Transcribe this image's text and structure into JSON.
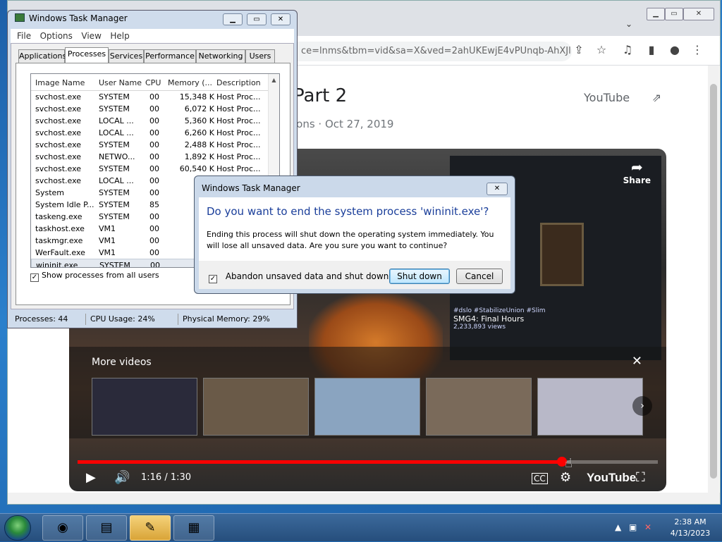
{
  "chrome": {
    "url": "ce=lnms&tbm=vid&sa=X&ved=2ahUKEwjE4vPUnqb-AhXJl...",
    "page_title": "Part 2",
    "page_subtitle": "ions · Oct 27, 2019",
    "youtube_button": "YouTube",
    "icons": [
      "share-icon",
      "bookmark-star-icon",
      "media-icon",
      "sidepanel-icon",
      "profile-icon",
      "menu-icon"
    ]
  },
  "video": {
    "share_label": "Share",
    "overlay_tag": "#dslo #StabilizeUnion #Slim",
    "overlay_title": "SMG4: Final Hours",
    "overlay_views": "2,233,893 views",
    "more_videos_label": "More videos",
    "timecode": "1:16 / 1:30",
    "progress_fraction": 0.835,
    "youtube_logo": "YouTube"
  },
  "taskmgr": {
    "title": "Windows Task Manager",
    "menu": [
      "File",
      "Options",
      "View",
      "Help"
    ],
    "tabs": [
      "Applications",
      "Processes",
      "Services",
      "Performance",
      "Networking",
      "Users"
    ],
    "active_tab": "Processes",
    "columns": [
      "Image Name",
      "User Name",
      "CPU",
      "Memory (...",
      "Description"
    ],
    "rows": [
      [
        "svchost.exe",
        "SYSTEM",
        "00",
        "15,348 K",
        "Host Proc..."
      ],
      [
        "svchost.exe",
        "SYSTEM",
        "00",
        "6,072 K",
        "Host Proc..."
      ],
      [
        "svchost.exe",
        "LOCAL ...",
        "00",
        "5,360 K",
        "Host Proc..."
      ],
      [
        "svchost.exe",
        "LOCAL ...",
        "00",
        "6,260 K",
        "Host Proc..."
      ],
      [
        "svchost.exe",
        "SYSTEM",
        "00",
        "2,488 K",
        "Host Proc..."
      ],
      [
        "svchost.exe",
        "NETWO...",
        "00",
        "1,892 K",
        "Host Proc..."
      ],
      [
        "svchost.exe",
        "SYSTEM",
        "00",
        "60,540 K",
        "Host Proc..."
      ],
      [
        "svchost.exe",
        "LOCAL ...",
        "00",
        "2,30",
        ""
      ],
      [
        "System",
        "SYSTEM",
        "00",
        "7",
        ""
      ],
      [
        "System Idle P...",
        "SYSTEM",
        "85",
        "2",
        ""
      ],
      [
        "taskeng.exe",
        "SYSTEM",
        "00",
        "1,74",
        ""
      ],
      [
        "taskhost.exe",
        "VM1",
        "00",
        "2,24",
        ""
      ],
      [
        "taskmgr.exe",
        "VM1",
        "00",
        "3,45",
        ""
      ],
      [
        "WerFault.exe",
        "VM1",
        "00",
        "2,76",
        ""
      ],
      [
        "wininit.exe",
        "SYSTEM",
        "00",
        "1,42",
        ""
      ]
    ],
    "selected_row": 14,
    "show_all_label": "Show processes from all users",
    "status": {
      "processes": "Processes: 44",
      "cpu": "CPU Usage: 24%",
      "memory": "Physical Memory: 29%"
    }
  },
  "dialog": {
    "title": "Windows Task Manager",
    "main_instruction": "Do you want to end the system process 'wininit.exe'?",
    "detail": "Ending this process will shut down the operating system immediately.  You will lose all unsaved data.  Are you sure you want to continue?",
    "checkbox_label": "Abandon unsaved data and shut down.",
    "checkbox_checked": true,
    "primary_button": "Shut down",
    "cancel_button": "Cancel"
  },
  "taskbar": {
    "time": "2:38 AM",
    "date": "4/13/2023"
  }
}
